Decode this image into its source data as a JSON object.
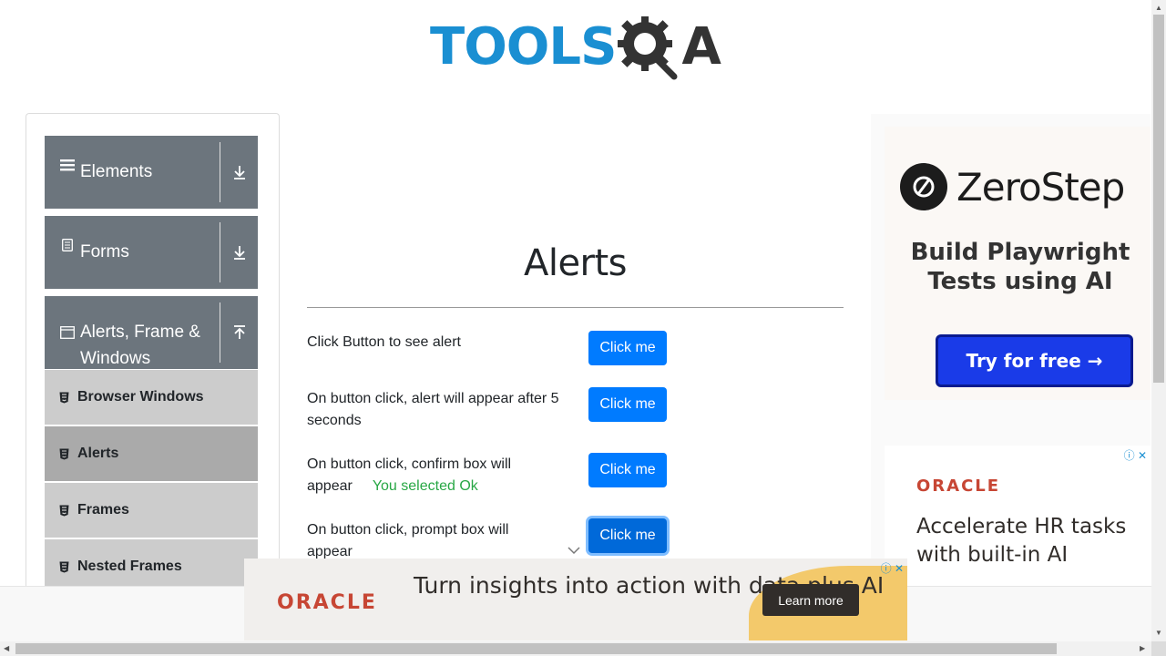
{
  "logo": {
    "part1": "TOOLS",
    "part2": "A"
  },
  "sidebar": {
    "groups": [
      {
        "label": "Elements",
        "icon": "menu-icon",
        "toggle": "download-icon"
      },
      {
        "label": "Forms",
        "icon": "document-icon",
        "toggle": "download-icon"
      },
      {
        "label": "Alerts, Frame & Windows",
        "icon": "window-icon",
        "toggle": "upload-icon"
      }
    ],
    "subitems": [
      {
        "label": "Browser Windows"
      },
      {
        "label": "Alerts"
      },
      {
        "label": "Frames"
      },
      {
        "label": "Nested Frames"
      }
    ]
  },
  "main": {
    "title": "Alerts",
    "rows": [
      {
        "text": "Click Button to see alert",
        "button": "Click me"
      },
      {
        "text": "On button click, alert will appear after 5 seconds",
        "button": "Click me"
      },
      {
        "text": "On button click, confirm box will appear",
        "result": "You selected Ok",
        "button": "Click me"
      },
      {
        "text": "On button click, prompt box will appear",
        "button": "Click me"
      }
    ]
  },
  "ads": {
    "zerostep": {
      "name": "ZeroStep",
      "tagline": "Build Playwright Tests using AI",
      "cta": "Try for free →"
    },
    "oracle_right": {
      "logo": "ORACLE",
      "text": "Accelerate HR tasks with built-in AI"
    },
    "oracle_bottom": {
      "logo": "ORACLE",
      "text": "Turn insights into action with data plus AI",
      "cta": "Learn more"
    },
    "adchoice": "ⓘ ✕"
  },
  "colors": {
    "primary": "#007bff",
    "sidebar_group": "#6c757d",
    "success": "#28a745",
    "brand_blue": "#1a8fd2",
    "oracle_red": "#c74634"
  }
}
